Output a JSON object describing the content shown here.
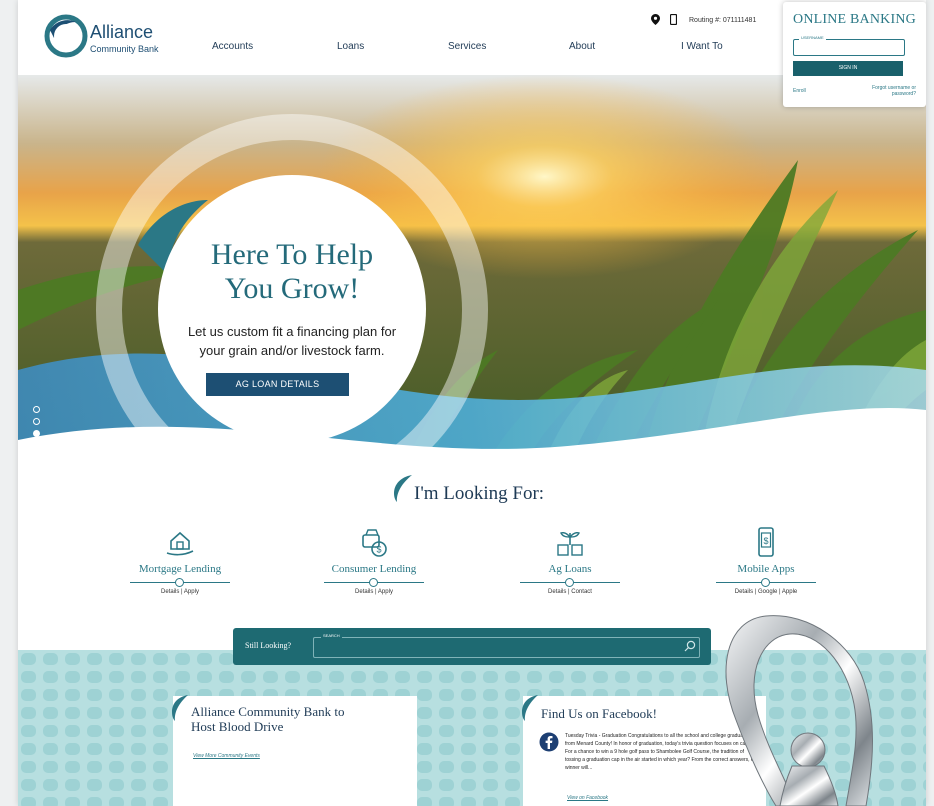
{
  "header": {
    "logo_name": "Alliance",
    "logo_sub": "Community Bank",
    "nav": [
      "Accounts",
      "Loans",
      "Services",
      "About",
      "I Want To"
    ],
    "routing_text": "Routing #: 071111481"
  },
  "online_banking": {
    "title": "ONLINE BANKING",
    "username_label": "USERNAME",
    "signin_label": "SIGN IN",
    "enroll_label": "Enroll",
    "forgot_label": "Forgot username or password?"
  },
  "hero": {
    "title_line1": "Here To Help",
    "title_line2": "You Grow!",
    "subtitle_line1": "Let us custom fit a financing plan for",
    "subtitle_line2": "your grain and/or livestock farm.",
    "button_label": "AG LOAN DETAILS",
    "slide_count": 4,
    "active_slide": 3
  },
  "looking_for": {
    "title": "I'm Looking For:",
    "categories": [
      {
        "name": "Mortgage Lending",
        "links": "Details | Apply",
        "icon": "house-hand-icon"
      },
      {
        "name": "Consumer Lending",
        "links": "Details | Apply",
        "icon": "car-money-icon"
      },
      {
        "name": "Ag Loans",
        "links": "Details | Contact",
        "icon": "plant-barn-icon"
      },
      {
        "name": "Mobile Apps",
        "links": "Details | Google | Apple",
        "icon": "mobile-dollar-icon"
      }
    ]
  },
  "search": {
    "label": "Still Looking?",
    "field_tag": "SEARCH"
  },
  "news": {
    "title_line1": "Alliance Community Bank to",
    "title_line2": "Host Blood Drive",
    "link": "View More Community Events"
  },
  "facebook": {
    "title": "Find Us on Facebook!",
    "post": "Tuesday Trivia - Graduation Congratulations to all the school and college graduates from Menard County! In honor of graduation, today's trivia question focuses on caps. For a chance to win a 9 hole golf pass to Shambolee Golf Course, the tradition of tossing a graduation cap in the air started in which year? From the correct answers, one winner will...",
    "link": "View on Facebook"
  },
  "colors": {
    "teal": "#2b7886",
    "navy": "#1d4f73",
    "dark_teal": "#1e6a72"
  }
}
